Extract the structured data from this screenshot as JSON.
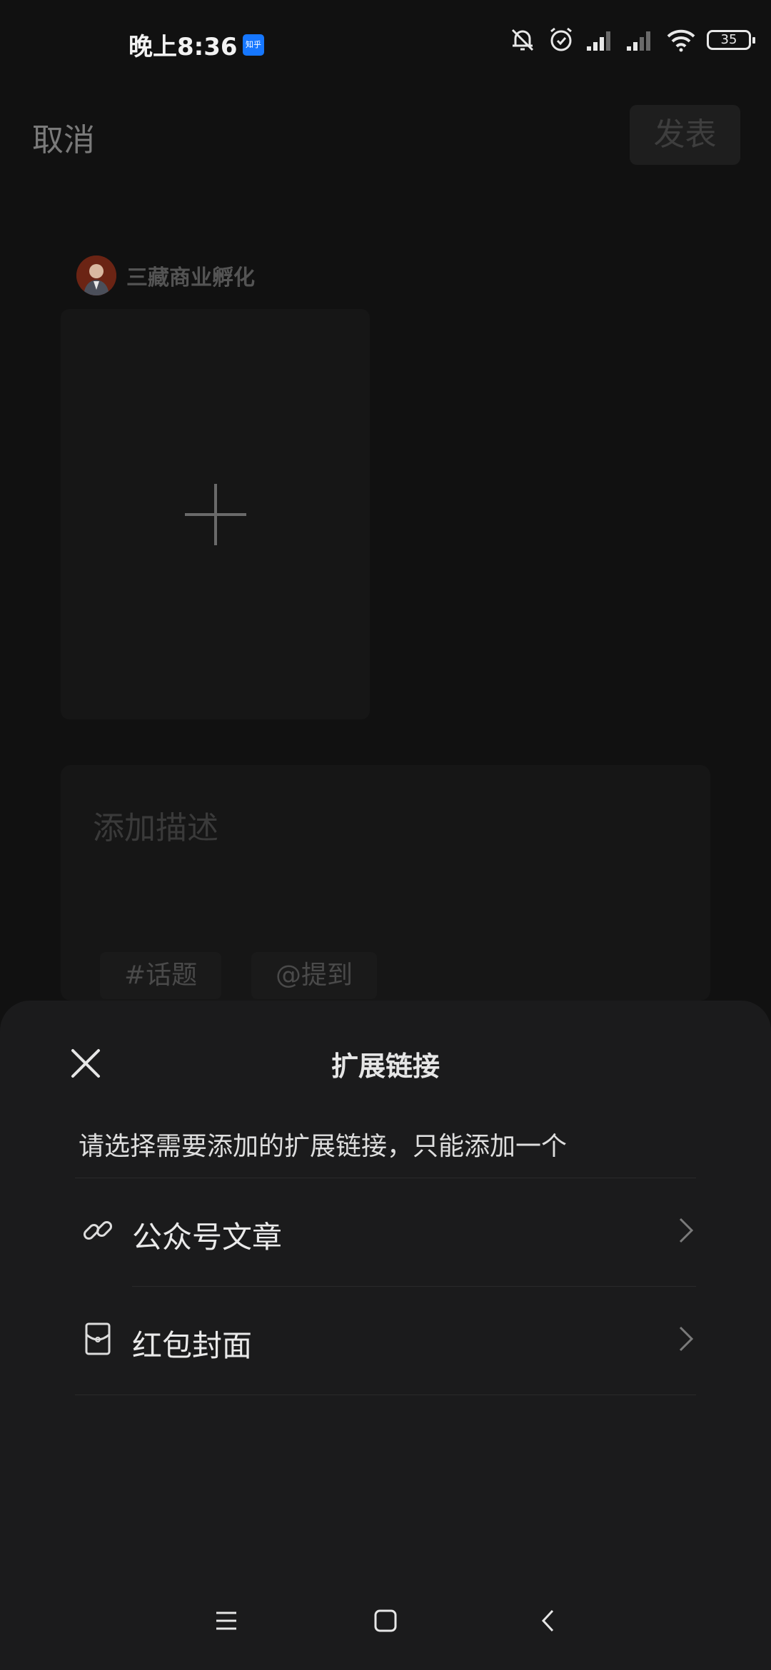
{
  "status_bar": {
    "time": "晚上8:36",
    "app_badge": "知乎",
    "battery": "35"
  },
  "header": {
    "cancel_label": "取消",
    "publish_label": "发表"
  },
  "author": {
    "name": "三藏商业孵化"
  },
  "description": {
    "placeholder": "添加描述",
    "topic_chip": "#话题",
    "mention_chip": "@提到"
  },
  "sheet": {
    "title": "扩展链接",
    "hint": "请选择需要添加的扩展链接，只能添加一个",
    "options": [
      {
        "label": "公众号文章",
        "icon": "link-icon"
      },
      {
        "label": "红包封面",
        "icon": "red-packet-icon"
      }
    ]
  },
  "nav": {
    "icons": [
      "menu-icon",
      "home-icon",
      "back-icon"
    ]
  }
}
